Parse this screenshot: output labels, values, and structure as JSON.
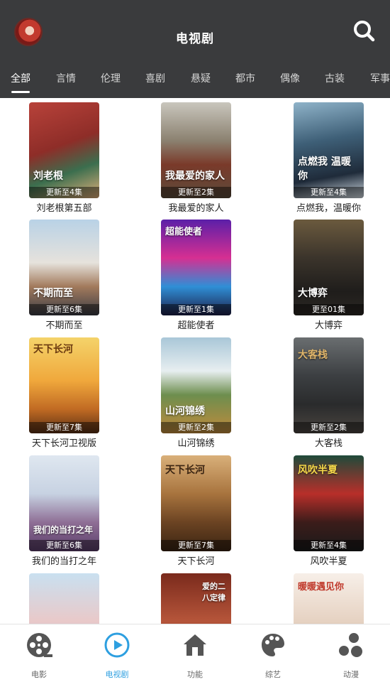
{
  "header": {
    "title": "电视剧"
  },
  "tabs": [
    {
      "label": "全部"
    },
    {
      "label": "言情"
    },
    {
      "label": "伦理"
    },
    {
      "label": "喜剧"
    },
    {
      "label": "悬疑"
    },
    {
      "label": "都市"
    },
    {
      "label": "偶像"
    },
    {
      "label": "古装"
    },
    {
      "label": "军事"
    }
  ],
  "shows": [
    {
      "title": "刘老根第五部",
      "status": "更新至4集",
      "poster_text": "刘老根"
    },
    {
      "title": "我最爱的家人",
      "status": "更新至2集",
      "poster_text": "我最爱的家人"
    },
    {
      "title": "点燃我，温暖你",
      "status": "更新至4集",
      "poster_text": "点燃我 温暖你"
    },
    {
      "title": "不期而至",
      "status": "更新至6集",
      "poster_text": "不期而至"
    },
    {
      "title": "超能使者",
      "status": "更新至1集",
      "poster_text": "超能使者"
    },
    {
      "title": "大博弈",
      "status": "更至01集",
      "poster_text": "大博弈"
    },
    {
      "title": "天下长河卫视版",
      "status": "更新至7集",
      "poster_text": "天下长河"
    },
    {
      "title": "山河锦绣",
      "status": "更新至2集",
      "poster_text": "山河锦绣"
    },
    {
      "title": "大客栈",
      "status": "更新至2集",
      "poster_text": "大客栈"
    },
    {
      "title": "我们的当打之年",
      "status": "更新至6集",
      "poster_text": "我们的当打之年"
    },
    {
      "title": "天下长河",
      "status": "更新至7集",
      "poster_text": "天下长河"
    },
    {
      "title": "风吹半夏",
      "status": "更新至4集",
      "poster_text": "风吹半夏"
    },
    {
      "title": "",
      "status": "",
      "poster_text": ""
    },
    {
      "title": "",
      "status": "",
      "poster_text": "爱的二八定律"
    },
    {
      "title": "",
      "status": "",
      "poster_text": "暖暖遇见你"
    }
  ],
  "bottom_nav": [
    {
      "label": "电影",
      "icon": "film-reel-icon"
    },
    {
      "label": "电视剧",
      "icon": "play-circle-icon"
    },
    {
      "label": "功能",
      "icon": "home-icon"
    },
    {
      "label": "综艺",
      "icon": "palette-icon"
    },
    {
      "label": "动漫",
      "icon": "bubbles-icon"
    }
  ],
  "colors": {
    "header_bg": "#3a3b3d",
    "active_nav": "#2d9fe0",
    "inactive_nav": "#666666"
  }
}
